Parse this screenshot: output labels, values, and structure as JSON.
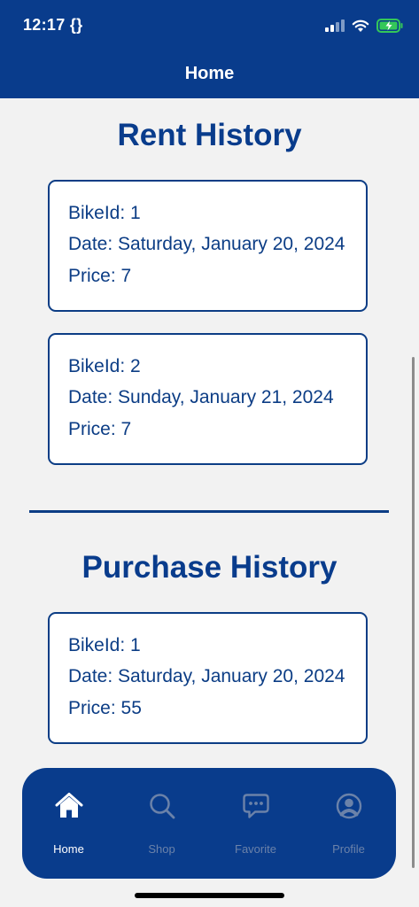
{
  "status_bar": {
    "time": "12:17 {}"
  },
  "header": {
    "title": "Home"
  },
  "rent_history": {
    "title": "Rent History",
    "items": [
      {
        "bike_id": "BikeId: 1",
        "date": "Date: Saturday, January 20, 2024",
        "price": "Price: 7"
      },
      {
        "bike_id": "BikeId: 2",
        "date": "Date: Sunday, January 21, 2024",
        "price": "Price: 7"
      }
    ]
  },
  "purchase_history": {
    "title": "Purchase History",
    "items": [
      {
        "bike_id": "BikeId: 1",
        "date": "Date: Saturday, January 20, 2024",
        "price": "Price: 55"
      }
    ]
  },
  "tabbar": {
    "tabs": [
      {
        "label": "Home",
        "icon": "home-icon",
        "active": true
      },
      {
        "label": "Shop",
        "icon": "search-icon",
        "active": false
      },
      {
        "label": "Favorite",
        "icon": "chat-icon",
        "active": false
      },
      {
        "label": "Profile",
        "icon": "profile-icon",
        "active": false
      }
    ]
  },
  "colors": {
    "primary": "#093c8c",
    "background": "#f2f2f2",
    "card_border": "#0c3d85",
    "inactive_tab": "#6b82a9",
    "battery": "#34c759"
  }
}
